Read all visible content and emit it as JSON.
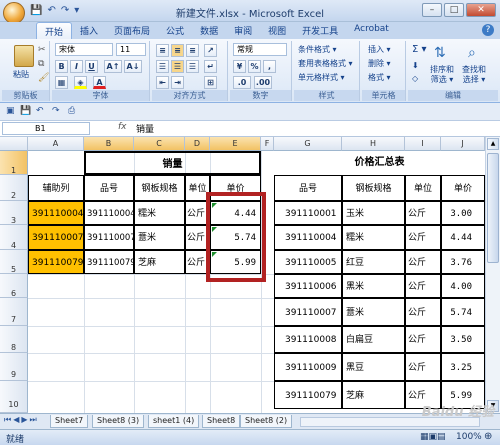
{
  "window": {
    "title": "新建文件.xlsx - Microsoft Excel",
    "min": "–",
    "max": "□",
    "close": "✕"
  },
  "quick_access": [
    "💾",
    "↶",
    "↷",
    "▾"
  ],
  "tabs": [
    "开始",
    "插入",
    "页面布局",
    "公式",
    "数据",
    "审阅",
    "视图",
    "开发工具",
    "Acrobat"
  ],
  "ribbon": {
    "clipboard": {
      "paste": "粘贴",
      "label": "剪贴板"
    },
    "font": {
      "name": "宋体",
      "size": "11",
      "bold": "B",
      "italic": "I",
      "underline": "U",
      "grow": "A↑",
      "shrink": "A↓",
      "label": "字体"
    },
    "alignment": {
      "label": "对齐方式"
    },
    "number": {
      "format": "常规",
      "currency": "%",
      "comma": ",",
      "label": "数字"
    },
    "styles": {
      "cond": "条件格式 ▾",
      "table": "套用表格格式 ▾",
      "cell": "单元格样式 ▾",
      "label": "样式"
    },
    "cells": {
      "insert": "插入 ▾",
      "delete": "删除 ▾",
      "format": "格式 ▾",
      "label": "单元格"
    },
    "editing": {
      "sum": "Σ ▾",
      "sort": "排序和\n筛选 ▾",
      "find": "查找和\n选择 ▾",
      "label": "编辑"
    }
  },
  "formula_bar": {
    "name": "B1",
    "fx": "fx",
    "value": "销量"
  },
  "columns": [
    "A",
    "B",
    "C",
    "D",
    "E",
    "F",
    "G",
    "H",
    "I",
    "J"
  ],
  "rows": [
    "1",
    "2",
    "3",
    "4",
    "5",
    "6",
    "7",
    "8",
    "9",
    "10"
  ],
  "left_table": {
    "title": "销量",
    "headers": [
      "辅助列",
      "品号",
      "钢板规格",
      "单位",
      "单价"
    ],
    "rows": [
      [
        "391110004",
        "391110004",
        "糯米",
        "公斤",
        "4.44"
      ],
      [
        "391110007",
        "391110007",
        "薏米",
        "公斤",
        "5.74"
      ],
      [
        "391110079",
        "391110079",
        "芝麻",
        "公斤",
        "5.99"
      ]
    ]
  },
  "right_table": {
    "title": "价格汇总表",
    "headers": [
      "品号",
      "钢板规格",
      "单位",
      "单价"
    ],
    "rows": [
      [
        "391110001",
        "玉米",
        "公斤",
        "3.00"
      ],
      [
        "391110004",
        "糯米",
        "公斤",
        "4.44"
      ],
      [
        "391110005",
        "红豆",
        "公斤",
        "3.76"
      ],
      [
        "391110006",
        "黑米",
        "公斤",
        "4.00"
      ],
      [
        "391110007",
        "薏米",
        "公斤",
        "5.74"
      ],
      [
        "391110008",
        "白扁豆",
        "公斤",
        "3.50"
      ],
      [
        "391110009",
        "黑豆",
        "公斤",
        "3.25"
      ],
      [
        "391110079",
        "芝麻",
        "公斤",
        "5.99"
      ]
    ]
  },
  "sheet_tabs": [
    "Sheet7",
    "Sheet8 (3)",
    "sheet1 (4)",
    "Sheet8",
    "Sheet8 (2)"
  ],
  "status": {
    "mode": "就绪",
    "zoom": "100%"
  },
  "watermark": "Baidu 经验",
  "colors": {
    "highlight": "#ffc000",
    "red_box": "#b22222"
  }
}
